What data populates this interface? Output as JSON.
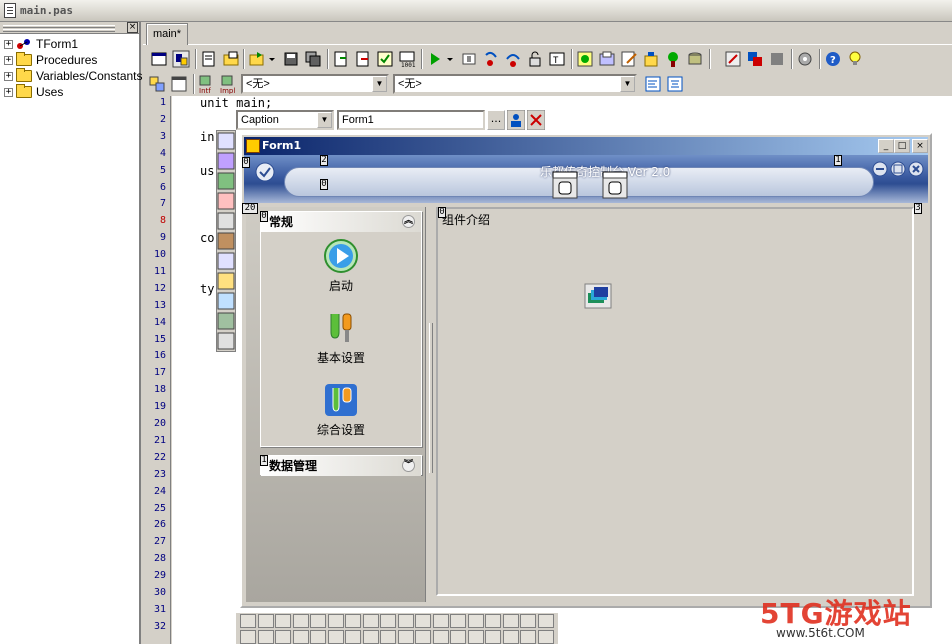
{
  "window": {
    "title": "main.pas"
  },
  "tree": {
    "items": [
      {
        "label": "TForm1",
        "expander": "+"
      },
      {
        "label": "Procedures",
        "expander": "+"
      },
      {
        "label": "Variables/Constants",
        "expander": "+"
      },
      {
        "label": "Uses",
        "expander": "+"
      }
    ]
  },
  "editor": {
    "tab_label": "main*",
    "combo_left": "<无>",
    "combo_right": "<无>",
    "line_numbers": [
      "1",
      "2",
      "3",
      "4",
      "5",
      "6",
      "7",
      "8",
      "9",
      "10",
      "11",
      "12",
      "13",
      "14",
      "15",
      "16",
      "17",
      "18",
      "19",
      "20",
      "21",
      "22",
      "23",
      "24",
      "25",
      "26",
      "27",
      "28",
      "29",
      "30",
      "31",
      "32"
    ],
    "highlighted_line": "8",
    "code_lines": [
      {
        "line": "1",
        "text": "unit main;"
      },
      {
        "line": "3",
        "text": "in"
      },
      {
        "line": "5",
        "text": "us"
      },
      {
        "line": "9",
        "text": "co"
      },
      {
        "line": "12",
        "text": "ty"
      }
    ]
  },
  "inspector": {
    "property": "Caption",
    "value": "Form1",
    "ellipsis": "..."
  },
  "form": {
    "caption": "Form1",
    "header_title": "乐都传奇控制台 Ver 2.0",
    "side_groups": [
      {
        "title": "常规",
        "chevron": "︽",
        "items": [
          "启动",
          "基本设置",
          "综合设置"
        ]
      },
      {
        "title": "数据管理",
        "chevron": "︾"
      }
    ],
    "content_title": "组件介绍",
    "markers": [
      "0",
      "2",
      "0",
      "1",
      "20",
      "0",
      "3",
      "1",
      "0"
    ]
  },
  "watermark": {
    "brand": "5TG游戏站",
    "site": "www.5t6t.COM"
  },
  "colors": {
    "title_bar": "#0a246a",
    "header_blue": "#3a5aa0",
    "line_highlight": "#c00000"
  }
}
